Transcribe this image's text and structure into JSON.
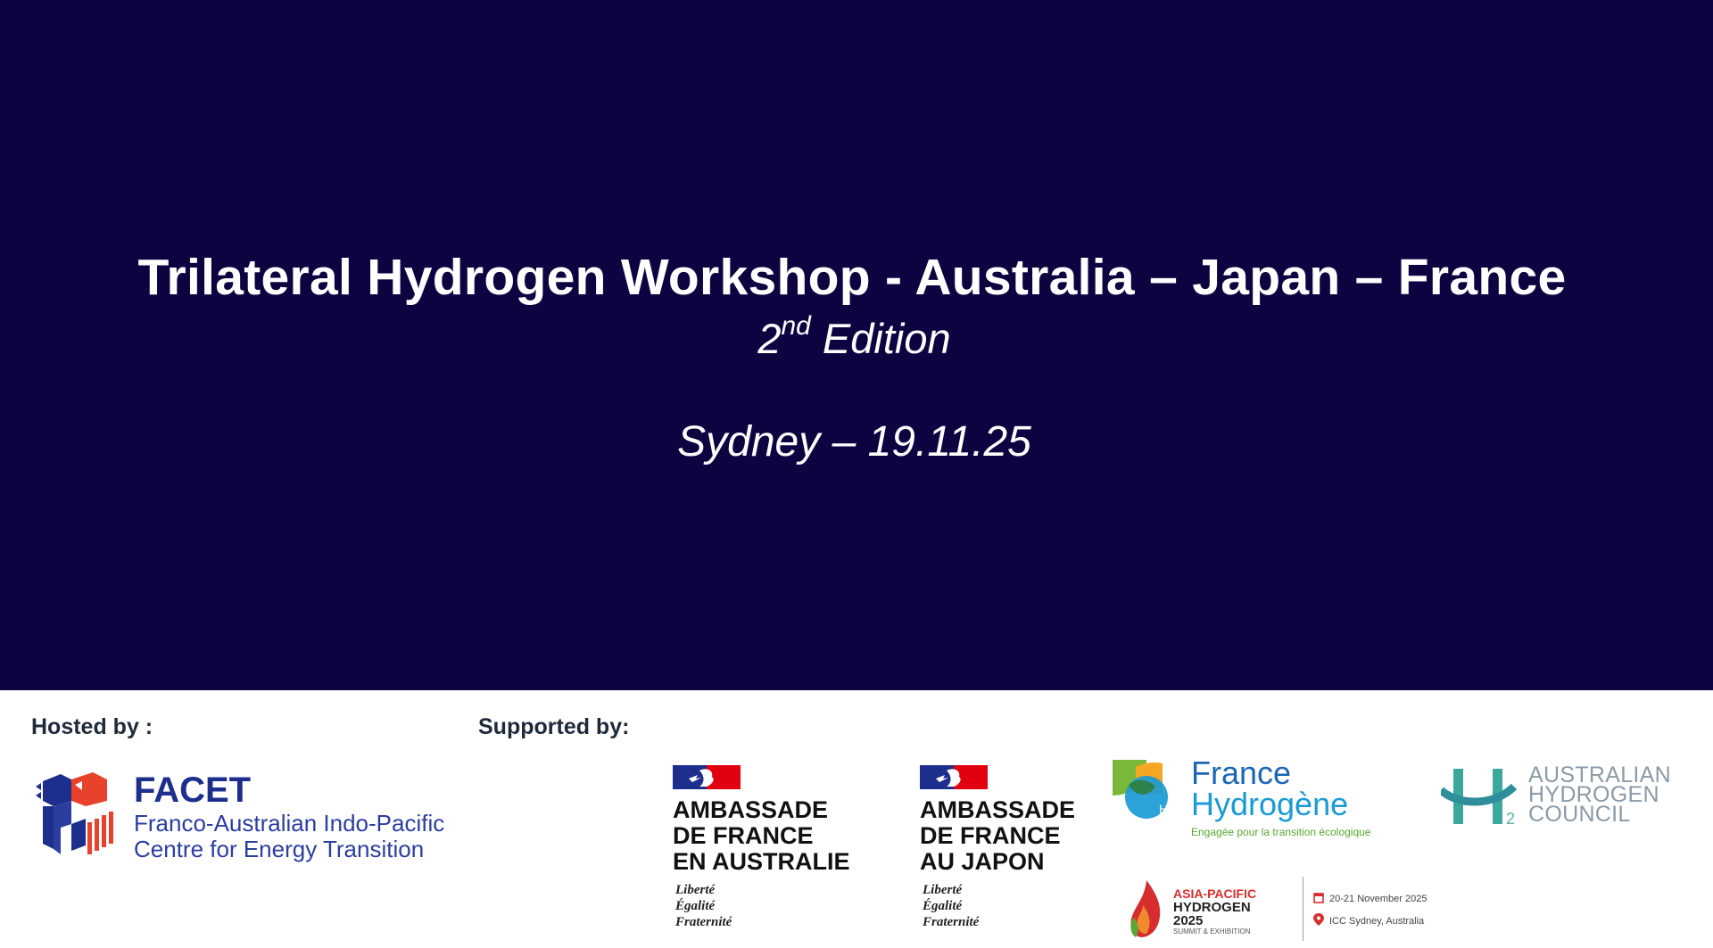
{
  "hero": {
    "title": "Trilateral Hydrogen Workshop - Australia – Japan – France",
    "edition_number": "2",
    "edition_suffix": "nd",
    "edition_word": " Edition",
    "place_date": "Sydney – 19.11.25",
    "background_color": "#0e0340"
  },
  "footer": {
    "hosted_label": "Hosted by :",
    "supported_label": "Supported by:",
    "host": {
      "name": "FACET",
      "line1": "Franco-Australian Indo-Pacific",
      "line2": "Centre for Energy Transition"
    },
    "embassy_au": {
      "line1": "AMBASSADE",
      "line2": "DE FRANCE",
      "line3": "EN AUSTRALIE",
      "motto1": "Liberté",
      "motto2": "Égalité",
      "motto3": "Fraternité"
    },
    "embassy_jp": {
      "line1": "AMBASSADE",
      "line2": "DE FRANCE",
      "line3": "AU JAPON",
      "motto1": "Liberté",
      "motto2": "Égalité",
      "motto3": "Fraternité"
    },
    "france_hydrogene": {
      "word1": "France",
      "word2": "Hydrogène",
      "tagline": "Engagée pour la transition écologique"
    },
    "ahc": {
      "line1": "AUSTRALIAN",
      "line2": "HYDROGEN",
      "line3": "COUNCIL"
    },
    "aph": {
      "line1": "ASIA-PACIFIC",
      "line2": "HYDROGEN",
      "line3": "2025",
      "line4": "SUMMIT & EXHIBITION",
      "dates": "20-21 November 2025",
      "location": "ICC Sydney, Australia"
    }
  }
}
